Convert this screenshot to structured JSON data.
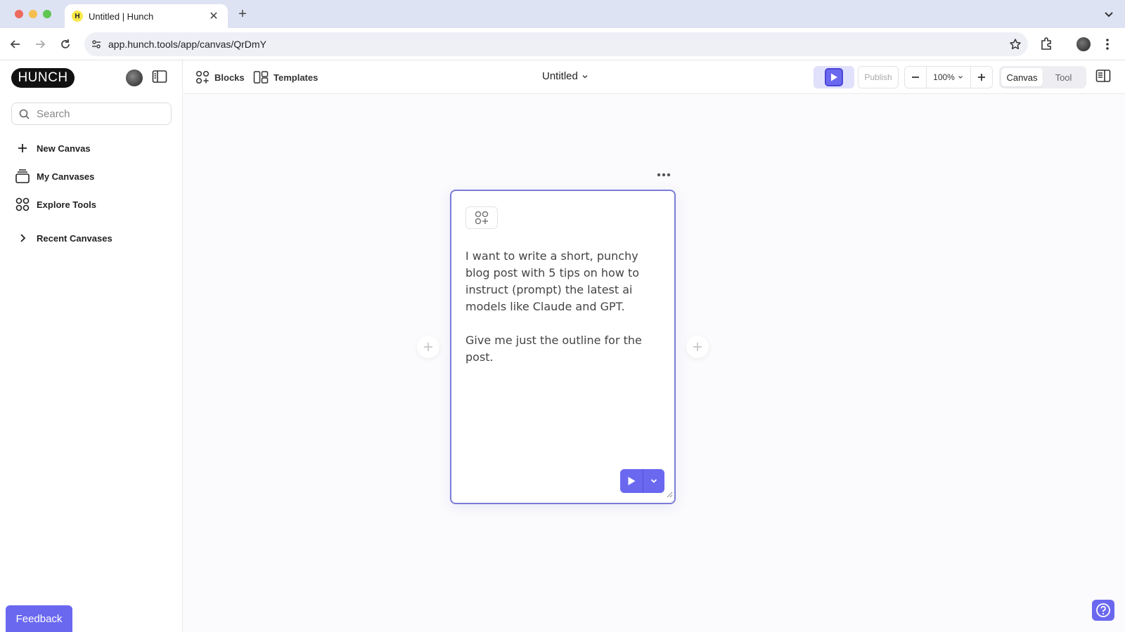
{
  "browser": {
    "tab_title": "Untitled | Hunch",
    "favicon_letter": "H",
    "url": "app.hunch.tools/app/canvas/QrDmY"
  },
  "sidebar": {
    "logo": "HUNCH",
    "search_placeholder": "Search",
    "items": [
      {
        "label": "New Canvas",
        "icon": "plus-icon"
      },
      {
        "label": "My Canvases",
        "icon": "stack-icon"
      },
      {
        "label": "Explore Tools",
        "icon": "grid-icon"
      },
      {
        "label": "Recent Canvases",
        "icon": "chevron-right-icon"
      }
    ],
    "feedback_label": "Feedback"
  },
  "toolbar": {
    "blocks_label": "Blocks",
    "templates_label": "Templates",
    "doc_title": "Untitled",
    "publish_label": "Publish",
    "zoom": "100%",
    "modes": [
      "Canvas",
      "Tool"
    ],
    "active_mode": "Canvas"
  },
  "block": {
    "prompt": "I want to write a short, punchy blog post with 5 tips on how to instruct (prompt) the latest ai models like Claude and GPT.\n\nGive me just the outline for the post."
  },
  "colors": {
    "accent": "#6b68f0",
    "block_border": "#7b7bd8",
    "tabbar": "#dde3f3"
  }
}
